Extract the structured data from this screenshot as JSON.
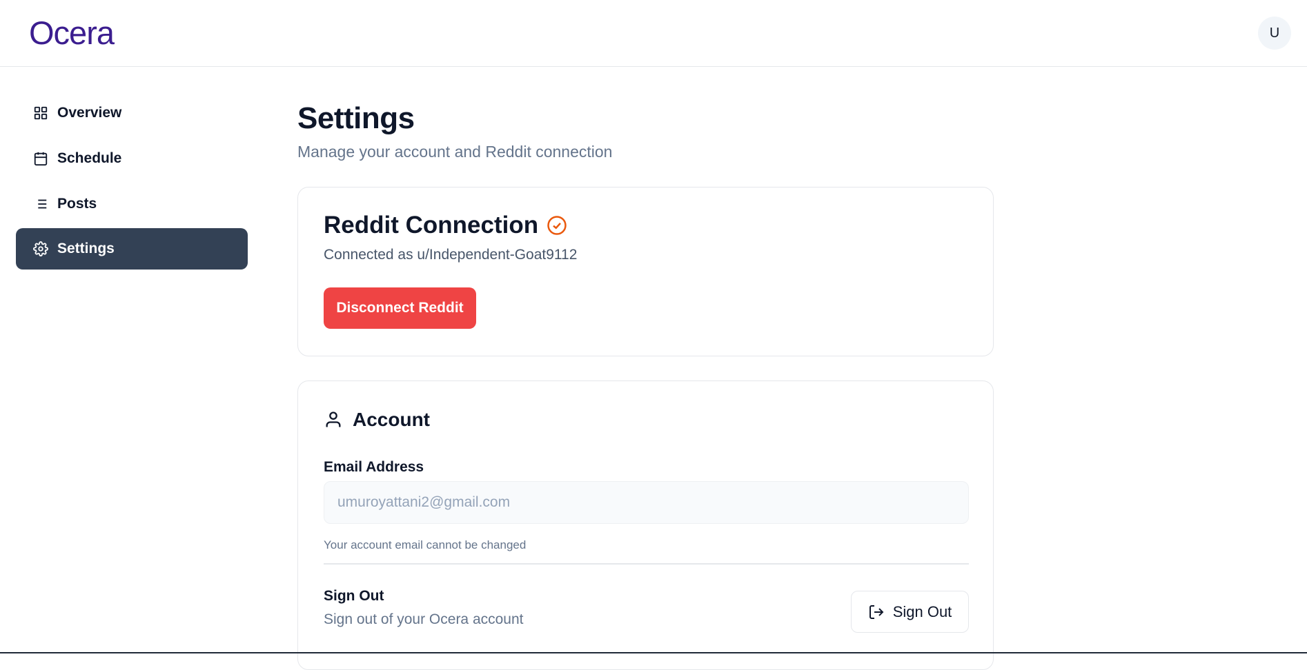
{
  "header": {
    "logo": "Ocera",
    "avatar_initial": "U"
  },
  "sidebar": {
    "items": [
      {
        "label": "Overview",
        "icon": "grid-icon"
      },
      {
        "label": "Schedule",
        "icon": "calendar-icon"
      },
      {
        "label": "Posts",
        "icon": "list-icon"
      },
      {
        "label": "Settings",
        "icon": "gear-icon",
        "active": true
      }
    ]
  },
  "page": {
    "title": "Settings",
    "subtitle": "Manage your account and Reddit connection"
  },
  "reddit": {
    "title": "Reddit Connection",
    "connected_text": "Connected as u/Independent-Goat9112",
    "disconnect_label": "Disconnect Reddit",
    "status_color": "#ea580c",
    "button_color": "#ef4444"
  },
  "account": {
    "title": "Account",
    "email_label": "Email Address",
    "email_value": "umuroyattani2@gmail.com",
    "email_help": "Your account email cannot be changed",
    "signout_title": "Sign Out",
    "signout_desc": "Sign out of your Ocera account",
    "signout_button": "Sign Out"
  },
  "colors": {
    "accent": "#3b1d8f",
    "sidebar_active": "#334155"
  }
}
